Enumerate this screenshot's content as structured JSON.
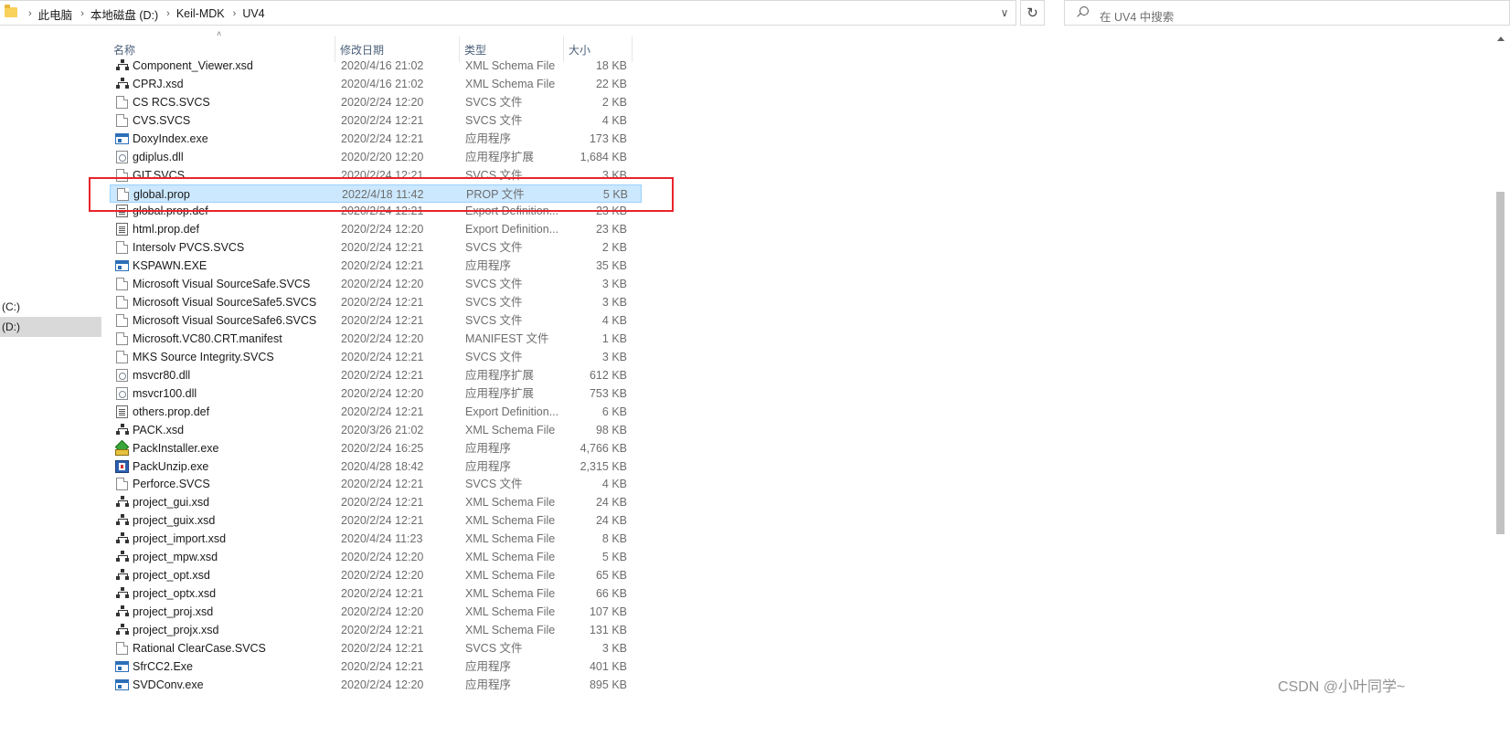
{
  "address_bar": {
    "breadcrumbs": [
      "此电脑",
      "本地磁盘 (D:)",
      "Keil-MDK",
      "UV4"
    ]
  },
  "search": {
    "placeholder": "在 UV4 中搜索"
  },
  "nav_pane": {
    "items": [
      {
        "label": "(C:)",
        "selected": false
      },
      {
        "label": "(D:)",
        "selected": true
      }
    ]
  },
  "columns": {
    "name": "名称",
    "date": "修改日期",
    "type": "类型",
    "size": "大小"
  },
  "files": [
    {
      "name": "Component_Viewer.xsd",
      "date": "2020/4/16 21:02",
      "type": "XML Schema File",
      "size": "18 KB",
      "icon": "xsd-icon"
    },
    {
      "name": "CPRJ.xsd",
      "date": "2020/4/16 21:02",
      "type": "XML Schema File",
      "size": "22 KB",
      "icon": "xsd-icon"
    },
    {
      "name": "CS RCS.SVCS",
      "date": "2020/2/24 12:20",
      "type": "SVCS 文件",
      "size": "2 KB",
      "icon": "file-icon"
    },
    {
      "name": "CVS.SVCS",
      "date": "2020/2/24 12:21",
      "type": "SVCS 文件",
      "size": "4 KB",
      "icon": "file-icon"
    },
    {
      "name": "DoxyIndex.exe",
      "date": "2020/2/24 12:21",
      "type": "应用程序",
      "size": "173 KB",
      "icon": "exe-icon"
    },
    {
      "name": "gdiplus.dll",
      "date": "2020/2/20 12:20",
      "type": "应用程序扩展",
      "size": "1,684 KB",
      "icon": "dll-icon"
    },
    {
      "name": "GIT.SVCS",
      "date": "2020/2/24 12:21",
      "type": "SVCS 文件",
      "size": "3 KB",
      "icon": "file-icon"
    },
    {
      "name": "global.prop",
      "date": "2022/4/18 11:42",
      "type": "PROP 文件",
      "size": "5 KB",
      "icon": "file-icon",
      "selected": true
    },
    {
      "name": "global.prop.def",
      "date": "2020/2/24 12:21",
      "type": "Export Definition...",
      "size": "23 KB",
      "icon": "def-icon"
    },
    {
      "name": "html.prop.def",
      "date": "2020/2/24 12:20",
      "type": "Export Definition...",
      "size": "23 KB",
      "icon": "def-icon"
    },
    {
      "name": "Intersolv PVCS.SVCS",
      "date": "2020/2/24 12:21",
      "type": "SVCS 文件",
      "size": "2 KB",
      "icon": "file-icon"
    },
    {
      "name": "KSPAWN.EXE",
      "date": "2020/2/24 12:21",
      "type": "应用程序",
      "size": "35 KB",
      "icon": "exe-icon"
    },
    {
      "name": "Microsoft Visual SourceSafe.SVCS",
      "date": "2020/2/24 12:20",
      "type": "SVCS 文件",
      "size": "3 KB",
      "icon": "file-icon"
    },
    {
      "name": "Microsoft Visual SourceSafe5.SVCS",
      "date": "2020/2/24 12:21",
      "type": "SVCS 文件",
      "size": "3 KB",
      "icon": "file-icon"
    },
    {
      "name": "Microsoft Visual SourceSafe6.SVCS",
      "date": "2020/2/24 12:21",
      "type": "SVCS 文件",
      "size": "4 KB",
      "icon": "file-icon"
    },
    {
      "name": "Microsoft.VC80.CRT.manifest",
      "date": "2020/2/24 12:20",
      "type": "MANIFEST 文件",
      "size": "1 KB",
      "icon": "file-icon"
    },
    {
      "name": "MKS Source Integrity.SVCS",
      "date": "2020/2/24 12:21",
      "type": "SVCS 文件",
      "size": "3 KB",
      "icon": "file-icon"
    },
    {
      "name": "msvcr80.dll",
      "date": "2020/2/24 12:21",
      "type": "应用程序扩展",
      "size": "612 KB",
      "icon": "dll-icon"
    },
    {
      "name": "msvcr100.dll",
      "date": "2020/2/24 12:20",
      "type": "应用程序扩展",
      "size": "753 KB",
      "icon": "dll-icon"
    },
    {
      "name": "others.prop.def",
      "date": "2020/2/24 12:21",
      "type": "Export Definition...",
      "size": "6 KB",
      "icon": "def-icon"
    },
    {
      "name": "PACK.xsd",
      "date": "2020/3/26 21:02",
      "type": "XML Schema File",
      "size": "98 KB",
      "icon": "xsd-icon"
    },
    {
      "name": "PackInstaller.exe",
      "date": "2020/2/24 16:25",
      "type": "应用程序",
      "size": "4,766 KB",
      "icon": "pack-installer-icon"
    },
    {
      "name": "PackUnzip.exe",
      "date": "2020/4/28 18:42",
      "type": "应用程序",
      "size": "2,315 KB",
      "icon": "pack-unzip-icon"
    },
    {
      "name": "Perforce.SVCS",
      "date": "2020/2/24 12:21",
      "type": "SVCS 文件",
      "size": "4 KB",
      "icon": "file-icon"
    },
    {
      "name": "project_gui.xsd",
      "date": "2020/2/24 12:21",
      "type": "XML Schema File",
      "size": "24 KB",
      "icon": "xsd-icon"
    },
    {
      "name": "project_guix.xsd",
      "date": "2020/2/24 12:21",
      "type": "XML Schema File",
      "size": "24 KB",
      "icon": "xsd-icon"
    },
    {
      "name": "project_import.xsd",
      "date": "2020/4/24 11:23",
      "type": "XML Schema File",
      "size": "8 KB",
      "icon": "xsd-icon"
    },
    {
      "name": "project_mpw.xsd",
      "date": "2020/2/24 12:20",
      "type": "XML Schema File",
      "size": "5 KB",
      "icon": "xsd-icon"
    },
    {
      "name": "project_opt.xsd",
      "date": "2020/2/24 12:20",
      "type": "XML Schema File",
      "size": "65 KB",
      "icon": "xsd-icon"
    },
    {
      "name": "project_optx.xsd",
      "date": "2020/2/24 12:21",
      "type": "XML Schema File",
      "size": "66 KB",
      "icon": "xsd-icon"
    },
    {
      "name": "project_proj.xsd",
      "date": "2020/2/24 12:20",
      "type": "XML Schema File",
      "size": "107 KB",
      "icon": "xsd-icon"
    },
    {
      "name": "project_projx.xsd",
      "date": "2020/2/24 12:21",
      "type": "XML Schema File",
      "size": "131 KB",
      "icon": "xsd-icon"
    },
    {
      "name": "Rational ClearCase.SVCS",
      "date": "2020/2/24 12:21",
      "type": "SVCS 文件",
      "size": "3 KB",
      "icon": "file-icon"
    },
    {
      "name": "SfrCC2.Exe",
      "date": "2020/2/24 12:21",
      "type": "应用程序",
      "size": "401 KB",
      "icon": "exe-icon"
    },
    {
      "name": "SVDConv.exe",
      "date": "2020/2/24 12:20",
      "type": "应用程序",
      "size": "895 KB",
      "icon": "exe-icon"
    }
  ],
  "watermark": "CSDN @小叶同学~",
  "colors": {
    "selection_bg": "#cce8ff",
    "selection_border": "#99d1ff",
    "annotation": "#e8242b"
  }
}
